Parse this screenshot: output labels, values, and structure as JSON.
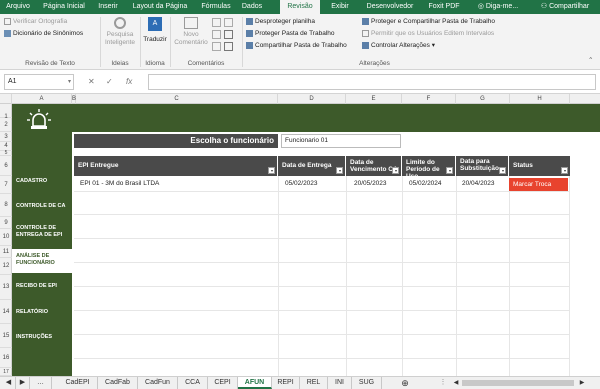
{
  "tabs": [
    "Arquivo",
    "Página Inicial",
    "Inserir",
    "Layout da Página",
    "Fórmulas",
    "Dados",
    "Revisão",
    "Exibir",
    "Desenvolvedor",
    "Foxit PDF",
    "Diga-me...",
    "Compartilhar"
  ],
  "ribbon": {
    "spell": "Verificar Ortografia",
    "thesaurus": "Dicionário de Sinônimos",
    "group_review": "Revisão de Texto",
    "smart": "Pesquisa Inteligente",
    "group_ideas": "Ideias",
    "translate": "Traduzir",
    "group_language": "Idioma",
    "new_comment": "Novo Comentário",
    "group_comments": "Comentários",
    "unprotect_sheet": "Desproteger planilha",
    "protect_workbook": "Proteger Pasta de Trabalho",
    "share_workbook": "Compartilhar Pasta de Trabalho",
    "protect_share": "Proteger e Compartilhar Pasta de Trabalho",
    "allow_edit": "Permitir que os Usuários Editem Intervalos",
    "track_changes": "Controlar Alterações",
    "group_changes": "Alterações"
  },
  "formula_bar": {
    "cell": "A1",
    "fx": "fx",
    "value": ""
  },
  "columns": [
    "A",
    "B",
    "C",
    "D",
    "E",
    "F",
    "G",
    "H"
  ],
  "rows": [
    "1",
    "2",
    "3",
    "4",
    "5",
    "6",
    "7",
    "8",
    "9",
    "10",
    "11",
    "12",
    "13",
    "14",
    "15",
    "16",
    "17"
  ],
  "sidebar": [
    "CADASTRO",
    "CONTROLE DE CA",
    "CONTROLE DE ENTREGA DE EPI",
    "ANÁLISE DE FUNCIONÁRIO",
    "RECIBO DE EPI",
    "RELATÓRIO",
    "INSTRUÇÕES"
  ],
  "form": {
    "title": "Escolha o funcionário",
    "employee": "Funcionario 01"
  },
  "table": {
    "headers": [
      "EPI Entregue",
      "Data de Entrega",
      "Data de Vencimento CA",
      "Limite do Período de Uso",
      "Data para Substituição",
      "Status"
    ],
    "rows": [
      [
        "EPI 01 - 3M do Brasil LTDA",
        "05/02/2023",
        "20/05/2023",
        "05/02/2024",
        "20/04/2023",
        "Marcar Troca"
      ]
    ]
  },
  "sheets": [
    "CadEPI",
    "CadFab",
    "CadFun",
    "CCA",
    "CEPI",
    "AFUN",
    "REPI",
    "REL",
    "INI",
    "SUG"
  ],
  "active_sheet": "AFUN",
  "colors": {
    "excel_green": "#217346",
    "sidebar": "#3d5a2a",
    "status_red": "#e8432e",
    "header_dark": "#4a4a4a"
  }
}
